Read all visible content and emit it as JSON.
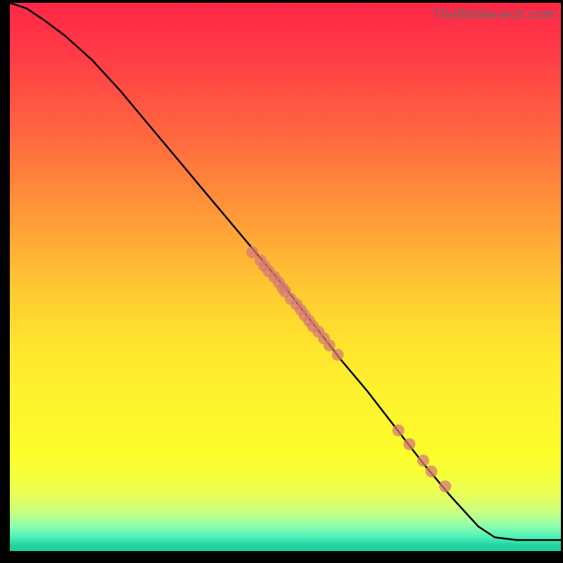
{
  "watermark": "TheBottleneck.com",
  "chart_data": {
    "type": "line",
    "title": "",
    "xlabel": "",
    "ylabel": "",
    "xlim": [
      0,
      100
    ],
    "ylim": [
      0,
      100
    ],
    "grid": false,
    "series": [
      {
        "name": "curve",
        "x": [
          0,
          3,
          6,
          10,
          15,
          20,
          25,
          30,
          35,
          40,
          45,
          50,
          55,
          60,
          65,
          70,
          75,
          80,
          85,
          88,
          92,
          95,
          100
        ],
        "y": [
          100,
          99,
          97,
          94,
          89.5,
          84,
          78,
          72,
          66,
          60,
          54,
          48,
          41.5,
          35,
          29,
          22.5,
          16,
          10,
          4.5,
          2.5,
          2,
          2,
          2
        ]
      }
    ],
    "points": {
      "name": "markers",
      "xy": [
        [
          44,
          54.5
        ],
        [
          45.5,
          53
        ],
        [
          46.2,
          52
        ],
        [
          47,
          51
        ],
        [
          48,
          50
        ],
        [
          48.8,
          49
        ],
        [
          49.5,
          48
        ],
        [
          50,
          47.3
        ],
        [
          51,
          46
        ],
        [
          52,
          45
        ],
        [
          52.8,
          44
        ],
        [
          53.5,
          43
        ],
        [
          54.3,
          42
        ],
        [
          55,
          41
        ],
        [
          56,
          40
        ],
        [
          57,
          38.8
        ],
        [
          58,
          37.5
        ],
        [
          59.5,
          35.8
        ],
        [
          70.5,
          22
        ],
        [
          72.5,
          19.5
        ],
        [
          75,
          16.5
        ],
        [
          76.5,
          14.5
        ],
        [
          79,
          11.8
        ]
      ]
    }
  }
}
